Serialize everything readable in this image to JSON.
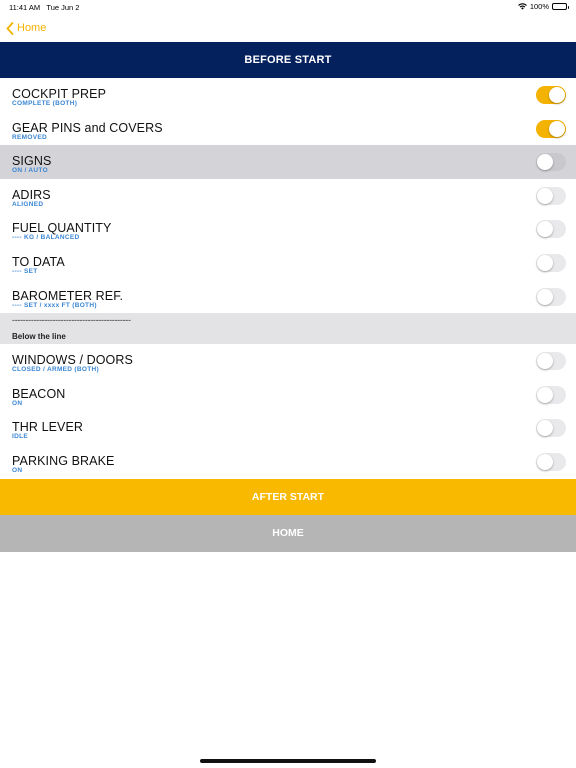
{
  "status_bar": {
    "time": "11:41 AM",
    "date": "Tue Jun 2",
    "battery": "100%",
    "wifi_icon": "wifi-icon",
    "battery_icon": "battery-icon"
  },
  "nav": {
    "back_label": "Home",
    "back_icon": "chevron-left-icon"
  },
  "header": {
    "title": "BEFORE START"
  },
  "colors": {
    "header_bg": "#04215e",
    "accent": "#f3b300",
    "subtitle": "#3a86d4",
    "home_button": "#b5b5b5"
  },
  "checklist_top": [
    {
      "title": "COCKPIT PREP",
      "subtitle": "COMPLETE (BOTH)",
      "checked": true,
      "highlighted": false
    },
    {
      "title": "GEAR PINS and COVERS",
      "subtitle": "REMOVED",
      "checked": true,
      "highlighted": false
    },
    {
      "title": "SIGNS",
      "subtitle": "ON / AUTO",
      "checked": false,
      "highlighted": true
    },
    {
      "title": "ADIRS",
      "subtitle": "ALIGNED",
      "checked": false,
      "highlighted": false
    },
    {
      "title": "FUEL QUANTITY",
      "subtitle": "---- KG / BALANCED",
      "checked": false,
      "highlighted": false
    },
    {
      "title": "TO DATA",
      "subtitle": "---- SET",
      "checked": false,
      "highlighted": false
    },
    {
      "title": "BAROMETER REF.",
      "subtitle": "---- SET / xxxx FT (BOTH)",
      "checked": false,
      "highlighted": false
    }
  ],
  "separator": {
    "dashes": "--------------------------------------------",
    "label": "Below the line"
  },
  "checklist_bottom": [
    {
      "title": "WINDOWS / DOORS",
      "subtitle": "CLOSED / ARMED (BOTH)",
      "checked": false,
      "highlighted": false
    },
    {
      "title": "BEACON",
      "subtitle": "ON",
      "checked": false,
      "highlighted": false
    },
    {
      "title": "THR LEVER",
      "subtitle": "IDLE",
      "checked": false,
      "highlighted": false
    },
    {
      "title": "PARKING BRAKE",
      "subtitle": "ON",
      "checked": false,
      "highlighted": false
    }
  ],
  "buttons": {
    "after_start": "AFTER START",
    "home": "HOME"
  }
}
